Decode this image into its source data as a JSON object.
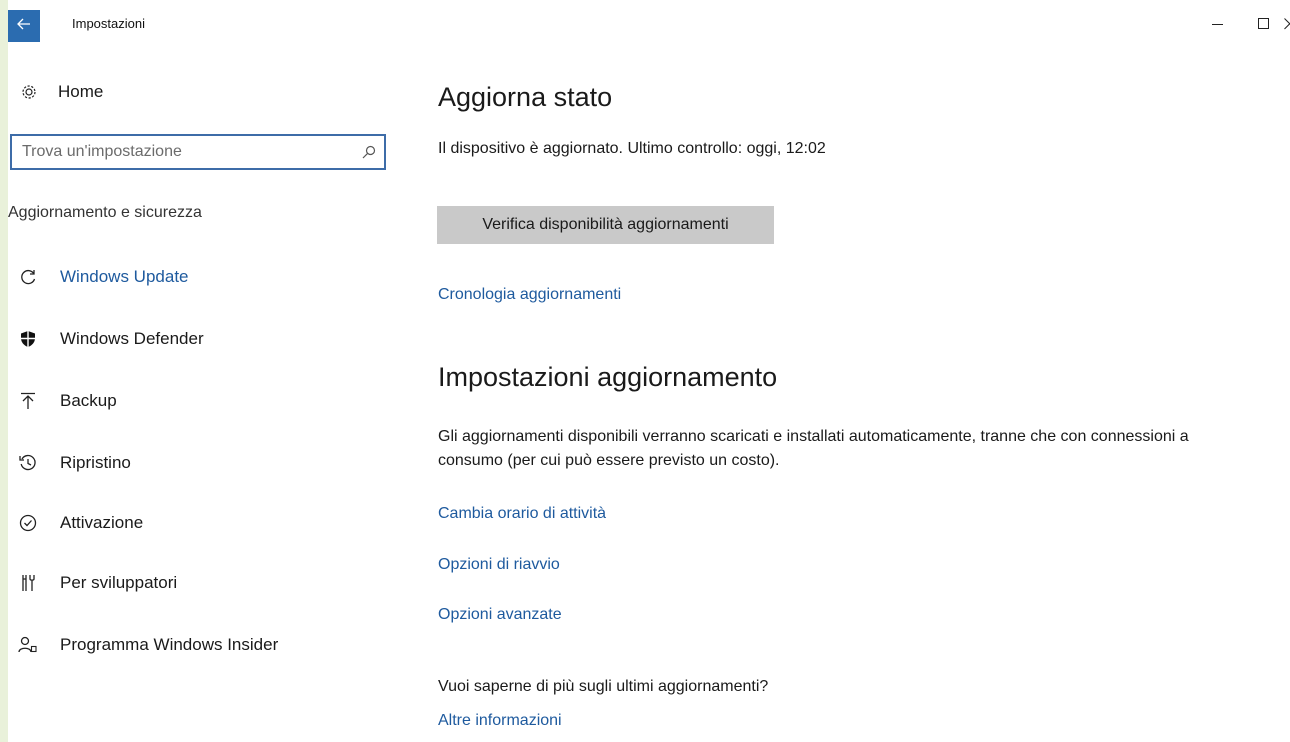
{
  "window": {
    "title": "Impostazioni",
    "back_icon": "back-arrow-icon",
    "controls": [
      "minimize-icon",
      "maximize-icon",
      "close-icon"
    ]
  },
  "sidebar": {
    "home": {
      "label": "Home",
      "icon": "gear-icon"
    },
    "search": {
      "value": "",
      "placeholder": "Trova un'impostazione",
      "icon": "search-icon"
    },
    "section_title": "Aggiornamento e sicurezza",
    "items": [
      {
        "label": "Windows Update",
        "icon": "sync-icon",
        "active": true
      },
      {
        "label": "Windows Defender",
        "icon": "shield-icon",
        "active": false
      },
      {
        "label": "Backup",
        "icon": "upload-icon",
        "active": false
      },
      {
        "label": "Ripristino",
        "icon": "history-icon",
        "active": false
      },
      {
        "label": "Attivazione",
        "icon": "check-circle-icon",
        "active": false
      },
      {
        "label": "Per sviluppatori",
        "icon": "tools-icon",
        "active": false
      },
      {
        "label": "Programma Windows Insider",
        "icon": "insider-person-icon",
        "active": false
      }
    ]
  },
  "main": {
    "status_heading": "Aggiorna stato",
    "status_text": "Il dispositivo è aggiornato. Ultimo controllo: oggi, 12:02",
    "check_button": "Verifica disponibilità aggiornamenti",
    "history_link": "Cronologia aggiornamenti",
    "settings_heading": "Impostazioni aggiornamento",
    "settings_description": "Gli aggiornamenti disponibili verranno scaricati e installati automaticamente, tranne che con connessioni a consumo (per cui può essere previsto un costo).",
    "links": {
      "active_hours": "Cambia orario di attività",
      "restart_options": "Opzioni di riavvio",
      "advanced_options": "Opzioni avanzate"
    },
    "more_question": "Vuoi saperne di più sugli ultimi aggiornamenti?",
    "more_link": "Altre informazioni"
  },
  "colors": {
    "accent": "#2b6cb0",
    "link": "#1e5a9e",
    "button_bg": "#c9c9c9",
    "outer_bg": "#e9f1da"
  }
}
